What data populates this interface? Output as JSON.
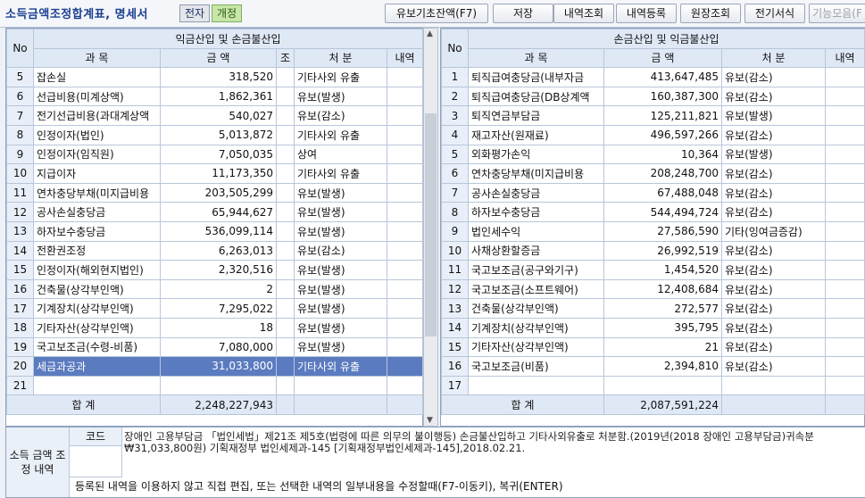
{
  "header": {
    "title": "소득금액조정합계표, 명세서",
    "chip_electronic": "전자",
    "chip_revised": "개정",
    "buttons": [
      "유보기초잔액(F7)",
      "저장",
      "내역조회",
      "내역등록",
      "원장조회",
      "전기서식",
      "기능모음(F"
    ]
  },
  "left_table": {
    "group_header": "익금산입 및 손금불산입",
    "columns": [
      "No",
      "과 목",
      "금 액",
      "조",
      "처 분",
      "내역"
    ],
    "rows": [
      {
        "no": "5",
        "subject": "잡손실",
        "amount": "318,520",
        "disposal": "기타사외 유출"
      },
      {
        "no": "6",
        "subject": "선급비용(미계상액)",
        "amount": "1,862,361",
        "disposal": "유보(발생)"
      },
      {
        "no": "7",
        "subject": "전기선급비용(과대계상액",
        "amount": "540,027",
        "disposal": "유보(감소)"
      },
      {
        "no": "8",
        "subject": "인정이자(법인)",
        "amount": "5,013,872",
        "disposal": "기타사외 유출"
      },
      {
        "no": "9",
        "subject": "인정이자(임직원)",
        "amount": "7,050,035",
        "disposal": "상여"
      },
      {
        "no": "10",
        "subject": "지급이자",
        "amount": "11,173,350",
        "disposal": "기타사외 유출"
      },
      {
        "no": "11",
        "subject": "연차충당부채(미지급비용",
        "amount": "203,505,299",
        "disposal": "유보(발생)"
      },
      {
        "no": "12",
        "subject": "공사손실충당금",
        "amount": "65,944,627",
        "disposal": "유보(발생)"
      },
      {
        "no": "13",
        "subject": "하자보수충당금",
        "amount": "536,099,114",
        "disposal": "유보(발생)"
      },
      {
        "no": "14",
        "subject": "전환권조정",
        "amount": "6,263,013",
        "disposal": "유보(감소)"
      },
      {
        "no": "15",
        "subject": "인정이자(해외현지법인)",
        "amount": "2,320,516",
        "disposal": "유보(발생)"
      },
      {
        "no": "16",
        "subject": "건축물(상각부인액)",
        "amount": "2",
        "disposal": "유보(발생)"
      },
      {
        "no": "17",
        "subject": "기계장치(상각부인액)",
        "amount": "7,295,022",
        "disposal": "유보(발생)"
      },
      {
        "no": "18",
        "subject": "기타자산(상각부인액)",
        "amount": "18",
        "disposal": "유보(발생)"
      },
      {
        "no": "19",
        "subject": "국고보조금(수령-비품)",
        "amount": "7,080,000",
        "disposal": "유보(발생)"
      },
      {
        "no": "20",
        "subject": "세금과공과",
        "amount": "31,033,800",
        "disposal": "기타사외 유출"
      },
      {
        "no": "21",
        "subject": "",
        "amount": "",
        "disposal": ""
      }
    ],
    "total_label": "합 계",
    "total_amount": "2,248,227,943"
  },
  "right_table": {
    "group_header": "손금산입 및 익금불산입",
    "columns": [
      "No",
      "과 목",
      "금 액",
      "처 분",
      "내역"
    ],
    "rows": [
      {
        "no": "1",
        "subject": "퇴직급여충당금(내부자금",
        "amount": "413,647,485",
        "disposal": "유보(감소)"
      },
      {
        "no": "2",
        "subject": "퇴직급여충당금(DB상계액",
        "amount": "160,387,300",
        "disposal": "유보(감소)"
      },
      {
        "no": "3",
        "subject": "퇴직연금부담금",
        "amount": "125,211,821",
        "disposal": "유보(발생)"
      },
      {
        "no": "4",
        "subject": "재고자산(원재료)",
        "amount": "496,597,266",
        "disposal": "유보(감소)"
      },
      {
        "no": "5",
        "subject": "외화평가손익",
        "amount": "10,364",
        "disposal": "유보(발생)"
      },
      {
        "no": "6",
        "subject": "연차충당부채(미지급비용",
        "amount": "208,248,700",
        "disposal": "유보(감소)"
      },
      {
        "no": "7",
        "subject": "공사손실충당금",
        "amount": "67,488,048",
        "disposal": "유보(감소)"
      },
      {
        "no": "8",
        "subject": "하자보수충당금",
        "amount": "544,494,724",
        "disposal": "유보(감소)"
      },
      {
        "no": "9",
        "subject": "법인세수익",
        "amount": "27,586,590",
        "disposal": "기타(잉여금증감)"
      },
      {
        "no": "10",
        "subject": "사채상환할증금",
        "amount": "26,992,519",
        "disposal": "유보(감소)"
      },
      {
        "no": "11",
        "subject": "국고보조금(공구와기구)",
        "amount": "1,454,520",
        "disposal": "유보(감소)"
      },
      {
        "no": "12",
        "subject": "국고보조금(소프트웨어)",
        "amount": "12,408,684",
        "disposal": "유보(감소)"
      },
      {
        "no": "13",
        "subject": "건축물(상각부인액)",
        "amount": "272,577",
        "disposal": "유보(감소)"
      },
      {
        "no": "14",
        "subject": "기계장치(상각부인액)",
        "amount": "395,795",
        "disposal": "유보(감소)"
      },
      {
        "no": "15",
        "subject": "기타자산(상각부인액)",
        "amount": "21",
        "disposal": "유보(감소)"
      },
      {
        "no": "16",
        "subject": "국고보조금(비품)",
        "amount": "2,394,810",
        "disposal": "유보(감소)"
      },
      {
        "no": "17",
        "subject": "",
        "amount": "",
        "disposal": ""
      }
    ],
    "total_label": "합 계",
    "total_amount": "2,087,591,224"
  },
  "bottom": {
    "label": "소득 금액 조정 내역",
    "code_label": "코드",
    "description": "장애인 고용부담금 「법인세법」제21조 제5호(법령에 따른 의무의 불이행등) 손금불산입하고 기타사외유출로 처분함.(2019년(2018 장애인 고용부담금)귀속분 ₩31,033,800원) 기획재정부 법인세제과-145 [기획재정부법인세제과-145],2018.02.21.",
    "hint": "등록된 내역을 이용하지 않고 직접 편집, 또는 선택한 내역의 일부내용을 수정할때(F7-이동키), 복귀(ENTER)"
  }
}
